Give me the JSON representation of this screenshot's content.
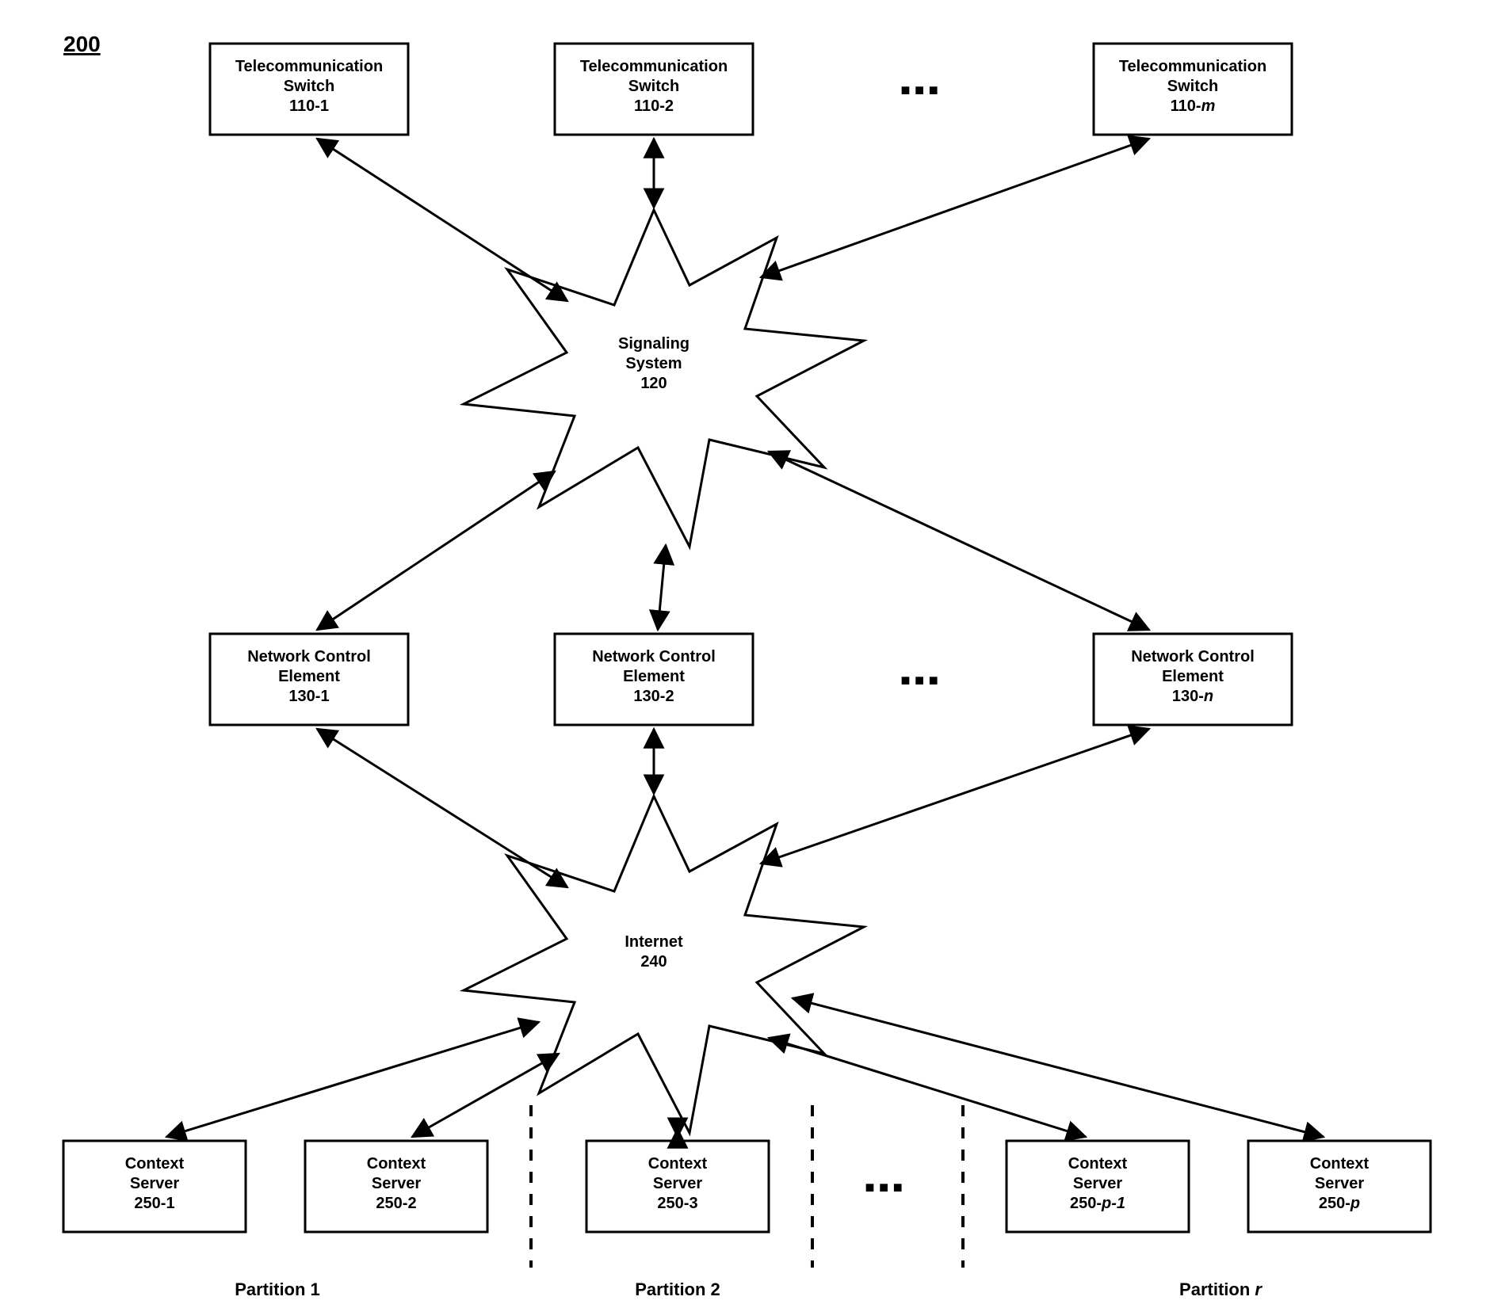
{
  "figure_number": "200",
  "switches": [
    {
      "line1": "Telecommunication",
      "line2": "Switch",
      "id_plain": "110-1",
      "id_ital": ""
    },
    {
      "line1": "Telecommunication",
      "line2": "Switch",
      "id_plain": "110-2",
      "id_ital": ""
    },
    {
      "line1": "Telecommunication",
      "line2": "Switch",
      "id_plain": "110-",
      "id_ital": "m"
    }
  ],
  "signaling": {
    "line1": "Signaling",
    "line2": "System",
    "id": "120"
  },
  "nces": [
    {
      "line1": "Network Control",
      "line2": "Element",
      "id_plain": "130-1",
      "id_ital": ""
    },
    {
      "line1": "Network Control",
      "line2": "Element",
      "id_plain": "130-2",
      "id_ital": ""
    },
    {
      "line1": "Network Control",
      "line2": "Element",
      "id_plain": "130-",
      "id_ital": "n"
    }
  ],
  "internet": {
    "line1": "Internet",
    "id": "240"
  },
  "servers": [
    {
      "line1": "Context",
      "line2": "Server",
      "id_plain": "250-1",
      "id_ital": ""
    },
    {
      "line1": "Context",
      "line2": "Server",
      "id_plain": "250-2",
      "id_ital": ""
    },
    {
      "line1": "Context",
      "line2": "Server",
      "id_plain": "250-3",
      "id_ital": ""
    },
    {
      "line1": "Context",
      "line2": "Server",
      "id_plain": "250-",
      "id_ital": "p-1"
    },
    {
      "line1": "Context",
      "line2": "Server",
      "id_plain": "250-",
      "id_ital": "p"
    }
  ],
  "partitions": [
    {
      "label": "Partition 1"
    },
    {
      "label": "Partition 2"
    },
    {
      "label_plain": "Partition ",
      "label_ital": "r"
    }
  ],
  "ellipsis": "■   ■   ■"
}
